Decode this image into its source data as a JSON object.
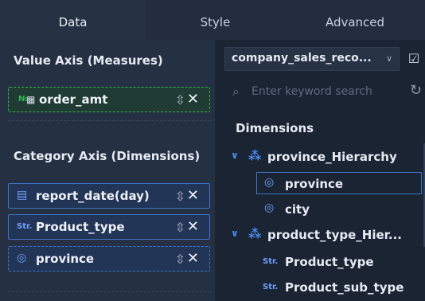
{
  "tabs": [
    {
      "label": "Data"
    },
    {
      "label": "Style"
    },
    {
      "label": "Advanced"
    }
  ],
  "left": {
    "value_axis_title": "Value Axis (Measures)",
    "measure_field": {
      "icon_text": "№",
      "label": "order_amt"
    },
    "category_axis_title": "Category Axis (Dimensions)",
    "dimensions": [
      {
        "icon": "calendar-icon",
        "label": "report_date(day)"
      },
      {
        "icon_text": "Str.",
        "label": "Product_type"
      },
      {
        "icon": "location-pin-icon",
        "label": "province"
      }
    ]
  },
  "right": {
    "dataset_name": "company_sales_reco...",
    "search_placeholder": "Enter keyword search",
    "dimensions_title": "Dimensions",
    "tree": [
      {
        "type": "hierarchy",
        "label": "province_Hierarchy"
      },
      {
        "type": "leaf",
        "icon": "location-pin-icon",
        "label": "province",
        "selected": true
      },
      {
        "type": "leaf",
        "icon": "location-pin-icon",
        "label": "city"
      },
      {
        "type": "hierarchy",
        "label": "product_type_Hier..."
      },
      {
        "type": "leaf",
        "icon_text": "Str.",
        "label": "Product_type"
      },
      {
        "type": "leaf",
        "icon_text": "Str.",
        "label": "Product_sub_type"
      }
    ]
  },
  "colors": {
    "accent": "#3d74c9",
    "measure_border": "#34b34f",
    "background": "#1b2433"
  }
}
